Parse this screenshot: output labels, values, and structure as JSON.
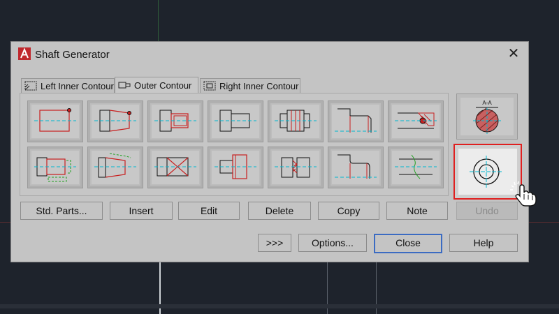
{
  "dialog": {
    "title": "Shaft Generator",
    "icon": "autocad-icon",
    "close_glyph": "✕"
  },
  "tabs": [
    {
      "label": "Left Inner Contour",
      "icon": "left-inner-contour-icon",
      "active": false
    },
    {
      "label": "Outer Contour",
      "icon": "outer-contour-icon",
      "active": true
    },
    {
      "label": "Right Inner Contour",
      "icon": "right-inner-contour-icon",
      "active": false
    }
  ],
  "tiles_row1": [
    {
      "name": "cylinder-tile",
      "icon": "cylinder-icon"
    },
    {
      "name": "cone-tile",
      "icon": "cone-icon"
    },
    {
      "name": "thread-tile",
      "icon": "thread-icon"
    },
    {
      "name": "profile-tile",
      "icon": "profile-icon"
    },
    {
      "name": "splines-tile",
      "icon": "splines-icon"
    },
    {
      "name": "chamfer-tile",
      "icon": "chamfer-icon"
    },
    {
      "name": "hole-tile",
      "icon": "hole-section-icon"
    }
  ],
  "tiles_row2": [
    {
      "name": "gear-tile",
      "icon": "gear-shaft-icon"
    },
    {
      "name": "pinion-tile",
      "icon": "pinion-icon"
    },
    {
      "name": "wrench-flat-tile",
      "icon": "wrench-flat-icon"
    },
    {
      "name": "groove-tile",
      "icon": "groove-icon"
    },
    {
      "name": "break-tile",
      "icon": "break-icon"
    },
    {
      "name": "fillet-tile",
      "icon": "fillet-icon"
    },
    {
      "name": "break-line-tile",
      "icon": "break-line-icon"
    }
  ],
  "section_tile": {
    "label": "A-A",
    "icon": "cross-section-icon"
  },
  "selected_tile": {
    "icon": "section-view-icon"
  },
  "row_buttons": [
    {
      "label": "Std. Parts...",
      "enabled": true
    },
    {
      "label": "Insert",
      "enabled": true
    },
    {
      "label": "Edit",
      "enabled": true
    },
    {
      "label": "Delete",
      "enabled": true
    },
    {
      "label": "Copy",
      "enabled": true
    },
    {
      "label": "Note",
      "enabled": true
    },
    {
      "label": "Undo",
      "enabled": false
    }
  ],
  "bottom_buttons": [
    {
      "label": ">>>"
    },
    {
      "label": "Options..."
    },
    {
      "label": "Close",
      "primary": true
    },
    {
      "label": "Help"
    }
  ],
  "colors": {
    "accent_red": "#e02020",
    "focus_blue": "#3b6bc2",
    "drawing_red": "#c81e1e",
    "drawing_cyan": "#00b7d0",
    "drawing_green": "#1fa01f"
  }
}
